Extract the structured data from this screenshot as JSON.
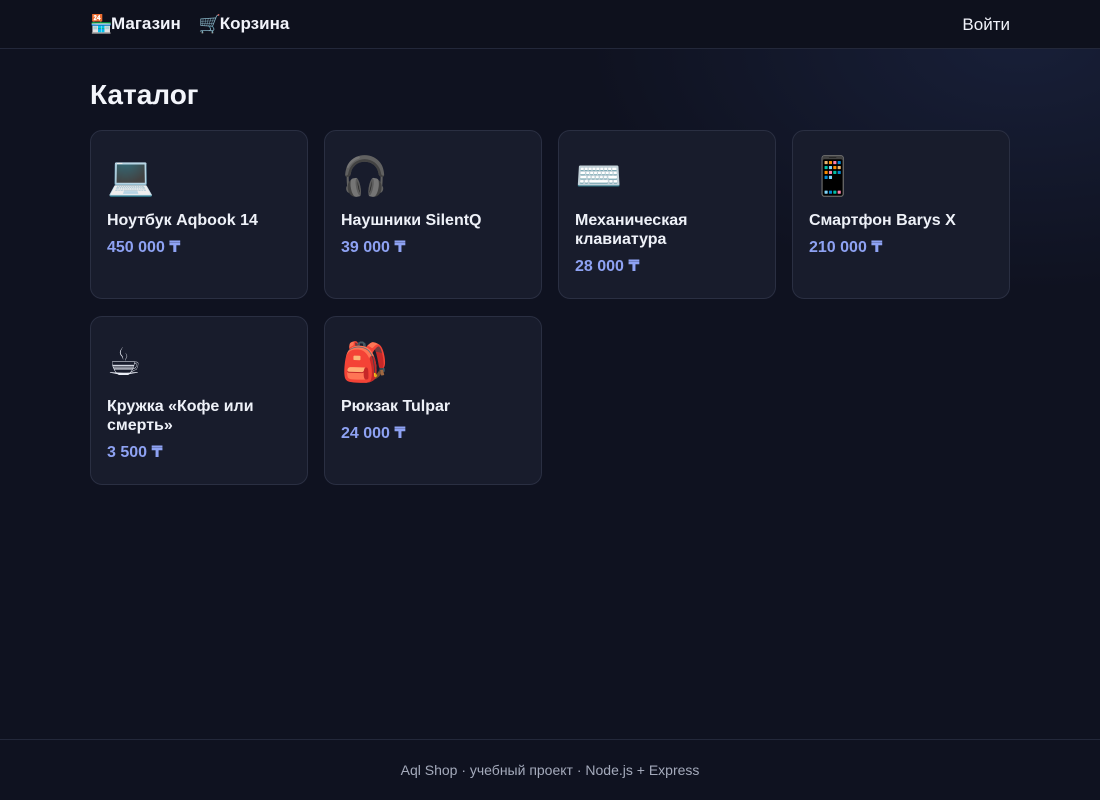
{
  "header": {
    "shop": {
      "icon": "🏪",
      "label": "Магазин"
    },
    "cart": {
      "icon": "🛒",
      "label": "Корзина"
    },
    "login_label": "Войти"
  },
  "main": {
    "title": "Каталог",
    "products": [
      {
        "emoji": "💻",
        "name": "Ноутбук Aqbook 14",
        "price": "450 000 ₸"
      },
      {
        "emoji": "🎧",
        "name": "Наушники SilentQ",
        "price": "39 000 ₸"
      },
      {
        "emoji": "⌨️",
        "name": "Механическая клавиатура",
        "price": "28 000 ₸"
      },
      {
        "emoji": "📱",
        "name": "Смартфон Barys X",
        "price": "210 000 ₸"
      },
      {
        "emoji": "☕",
        "name": "Кружка «Кофе или смерть»",
        "price": "3 500 ₸"
      },
      {
        "emoji": "🎒",
        "name": "Рюкзак Tulpar",
        "price": "24 000 ₸"
      }
    ]
  },
  "footer": {
    "text": "Aql Shop · учебный проект · Node.js + Express"
  }
}
